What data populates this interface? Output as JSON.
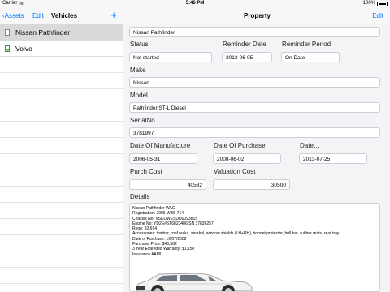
{
  "status_bar": {
    "carrier": "Carrier",
    "time": "5:46 PM",
    "battery": "100%"
  },
  "left_nav": {
    "back_label": "Assets",
    "edit_label": "Edit",
    "title": "Vehicles",
    "add_label": "+"
  },
  "vehicles": [
    {
      "label": "Nissan Pathfinder",
      "selected": true
    },
    {
      "label": "Volvo",
      "selected": false
    }
  ],
  "right_nav": {
    "title": "Property",
    "edit_label": "Edit"
  },
  "property": {
    "name": "Nissan Pathfinder",
    "status_label": "Status",
    "status_value": "Not started",
    "reminder_date_label": "Reminder Date",
    "reminder_date_value": "2013-06-05",
    "reminder_period_label": "Reminder Period",
    "reminder_period_value": "On Date",
    "make_label": "Make",
    "make_value": "Nissan",
    "model_label": "Model",
    "model_value": "Pathfinder ST-L Diesel",
    "serial_label": "SerialNo",
    "serial_value": "3781997",
    "manufacture_label": "Date Of Manufacture",
    "manufacture_value": "2006-05-31",
    "purchase_label": "Date Of Purchase",
    "purchase_value": "2008-06-02",
    "date_label": "Date…",
    "date_value": "2013-07-25",
    "purch_cost_label": "Purch Cost",
    "purch_cost_value": "40582",
    "valuation_label": "Valuation Cost",
    "valuation_value": "30500",
    "details_label": "Details",
    "details_text": "Nissan Pathfinder WAG\nRegistration: 2006 WBS 714\nChassis No: VSKDWESDD0093815\nEngine No: YD2E#ST6823486 SN 37836257\nRego: 32,694\nAccessories: towbar, roof racks, snorkel, window shields (LH+RH), bonnet protector, bull bar, rubber mats, rear tray.\nDate of Purchase: 19/07/2008\nPurchase Price: $40,582\n3 Year Extended Warranty: $1,150\nInsurance AAMI"
  },
  "colors": {
    "accent": "#007aff",
    "selected_row": "#d9d9d9",
    "car_body": "#f2f2f2"
  }
}
